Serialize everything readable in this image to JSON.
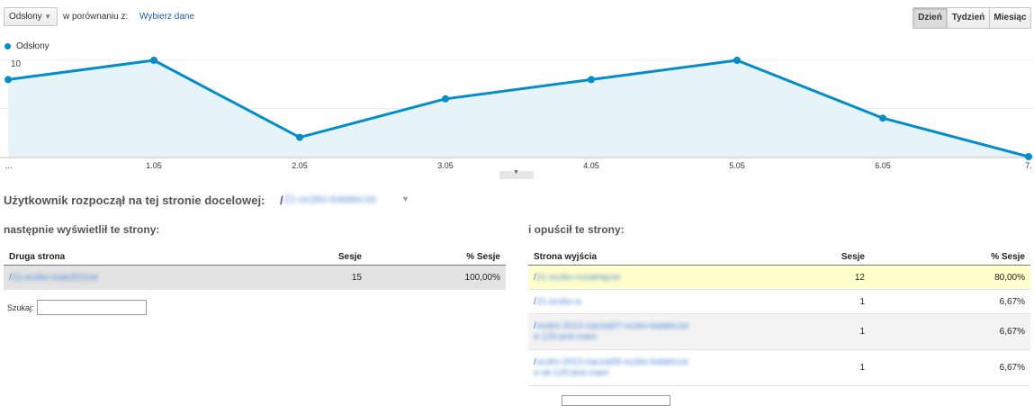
{
  "toolbar": {
    "metric_select": "Odsłony",
    "compare_label": "w porównaniu z:",
    "compare_link": "Wybierz dane",
    "periods": [
      "Dzień",
      "Tydzień",
      "Miesiąc"
    ],
    "active_period": "Dzień"
  },
  "legend": {
    "series_name": "Odsłony",
    "color": "#058dc7"
  },
  "chart_data": {
    "type": "area",
    "x_labels": [
      "...",
      "1.05",
      "2.05",
      "3.05",
      "4.05",
      "5.05",
      "6.05",
      "7."
    ],
    "values": [
      8,
      10,
      2,
      6,
      8,
      10,
      4,
      0
    ],
    "y_ticks": [
      10,
      5
    ],
    "ylim": [
      0,
      10
    ],
    "series_color": "#058dc7",
    "fill_color": "#e6f3f9",
    "grid": true
  },
  "landing": {
    "label": "Użytkownik rozpoczął na tej stronie docelowej:",
    "path_prefix": "/",
    "path_blurred": "21-oczko-kalatecze"
  },
  "left_section": {
    "title": "następnie wyświetlił te strony:",
    "columns": [
      "Druga strona",
      "Sesje",
      "% Sesje"
    ],
    "rows": [
      {
        "page_prefix": "/",
        "page_blurred": "21-oczko-czas2011ze",
        "sessions": "15",
        "percent": "100,00%"
      }
    ],
    "search_label": "Szukaj:"
  },
  "right_section": {
    "title": "i opuścił te strony:",
    "columns": [
      "Strona wyjścia",
      "Sesje",
      "% Sesje"
    ],
    "rows": [
      {
        "page_prefix": "/",
        "page_blurred": "21-oczko-rozwinięcie",
        "sessions": "12",
        "percent": "80,00%"
      },
      {
        "page_prefix": "/",
        "page_blurred": "21-oczko-a",
        "sessions": "1",
        "percent": "6,67%"
      },
      {
        "page_prefix": "/",
        "page_blurred": "oczko-2013-zaczej07-oczko-kalatecze",
        "page_blurred_2": "e-120-jest-mam",
        "sessions": "1",
        "percent": "6,67%"
      },
      {
        "page_prefix": "/",
        "page_blurred": "oczko-2013-zaczej05-oczko-kalatecze",
        "page_blurred_2": "e-sk-120-jest-mam",
        "sessions": "1",
        "percent": "6,67%"
      }
    ]
  }
}
